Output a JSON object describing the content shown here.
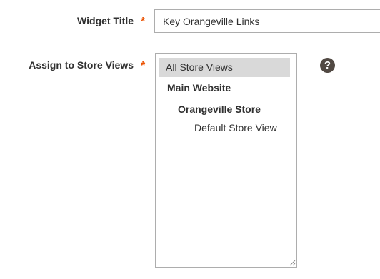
{
  "widget_title": {
    "label": "Widget Title",
    "required_marker": "*",
    "value": "Key Orangeville Links"
  },
  "store_views": {
    "label": "Assign to Store Views",
    "required_marker": "*",
    "options": [
      {
        "label": "All Store Views",
        "selected": true,
        "level": 0
      },
      {
        "label": "Main Website",
        "selected": false,
        "level": 1,
        "group": true
      },
      {
        "label": "Orangeville Store",
        "selected": false,
        "level": 2,
        "group": true
      },
      {
        "label": "Default Store View",
        "selected": false,
        "level": 3
      }
    ],
    "help_icon": "question-mark-icon",
    "help_glyph": "?"
  },
  "colors": {
    "required": "#eb5202",
    "selected_option_bg": "#d9d9d9",
    "help_icon_bg": "#514943",
    "border": "#adadad"
  }
}
